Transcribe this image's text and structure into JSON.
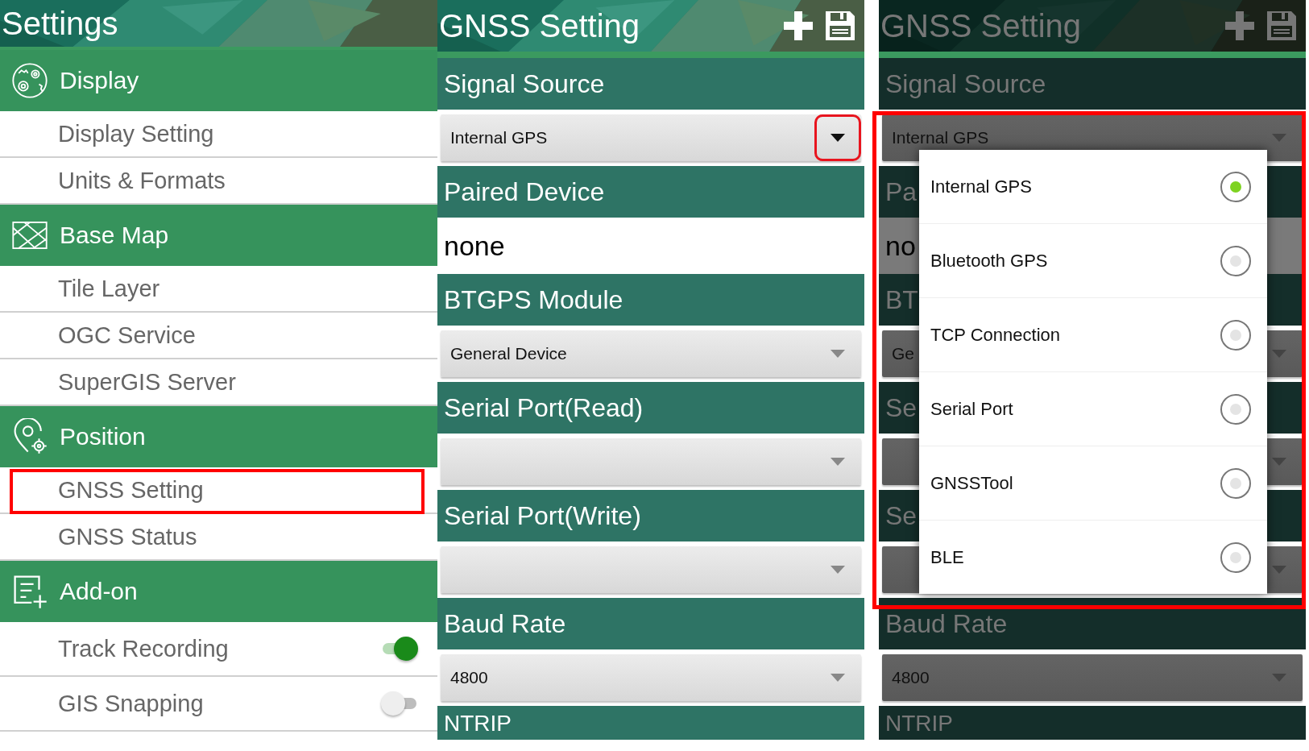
{
  "settings_panel": {
    "title": "Settings",
    "groups": [
      {
        "label": "Display",
        "items": [
          {
            "label": "Display Setting",
            "kind": "link",
            "highlighted": false
          },
          {
            "label": "Units & Formats",
            "kind": "link",
            "highlighted": false
          }
        ]
      },
      {
        "label": "Base Map",
        "items": [
          {
            "label": "Tile Layer",
            "kind": "link",
            "highlighted": false
          },
          {
            "label": "OGC Service",
            "kind": "link",
            "highlighted": false
          },
          {
            "label": "SuperGIS Server",
            "kind": "link",
            "highlighted": false
          }
        ]
      },
      {
        "label": "Position",
        "items": [
          {
            "label": "GNSS Setting",
            "kind": "link",
            "highlighted": true
          },
          {
            "label": "GNSS Status",
            "kind": "link",
            "highlighted": false
          }
        ]
      },
      {
        "label": "Add-on",
        "items": [
          {
            "label": "Track Recording",
            "kind": "toggle",
            "on": true,
            "highlighted": false
          },
          {
            "label": "GIS Snapping",
            "kind": "toggle",
            "on": false,
            "highlighted": false
          }
        ]
      }
    ]
  },
  "gnss_panel": {
    "title": "GNSS Setting",
    "fields": [
      {
        "label": "Signal Source",
        "kind": "dropdown",
        "value": "Internal GPS",
        "highlighted": true
      },
      {
        "label": "Paired Device",
        "kind": "text",
        "value": "none"
      },
      {
        "label": "BTGPS Module",
        "kind": "dropdown",
        "value": "General Device",
        "highlighted": false
      },
      {
        "label": "Serial Port(Read)",
        "kind": "dropdown",
        "highlighted": false
      },
      {
        "label": "Serial Port(Write)",
        "kind": "dropdown",
        "highlighted": false
      },
      {
        "label": "Baud Rate",
        "kind": "dropdown",
        "value": "4800",
        "highlighted": false
      },
      {
        "label": "NTRIP",
        "kind": "heading"
      }
    ]
  },
  "dialog_panel": {
    "title": "GNSS Setting",
    "fields": [
      {
        "label": "Signal Source",
        "kind": "dropdown",
        "value": "Internal GPS",
        "highlighted": false
      },
      {
        "label": "Pa",
        "kind": "text",
        "value": "no"
      },
      {
        "label": "BT",
        "kind": "dropdown",
        "value": "Ge",
        "highlighted": false
      },
      {
        "label": "Se",
        "kind": "dropdown",
        "highlighted": false
      },
      {
        "label": "Se",
        "kind": "dropdown",
        "highlighted": false
      },
      {
        "label": "Baud Rate",
        "kind": "dropdown",
        "value": "4800",
        "highlighted": false
      },
      {
        "label": "NTRIP",
        "kind": "heading"
      }
    ],
    "dialog": {
      "highlighted": true,
      "options": [
        {
          "label": "Internal GPS",
          "selected": true
        },
        {
          "label": "Bluetooth GPS",
          "selected": false
        },
        {
          "label": "TCP Connection",
          "selected": false
        },
        {
          "label": "Serial Port",
          "selected": false
        },
        {
          "label": "GNSSTool",
          "selected": false
        },
        {
          "label": "BLE",
          "selected": false
        }
      ]
    }
  }
}
